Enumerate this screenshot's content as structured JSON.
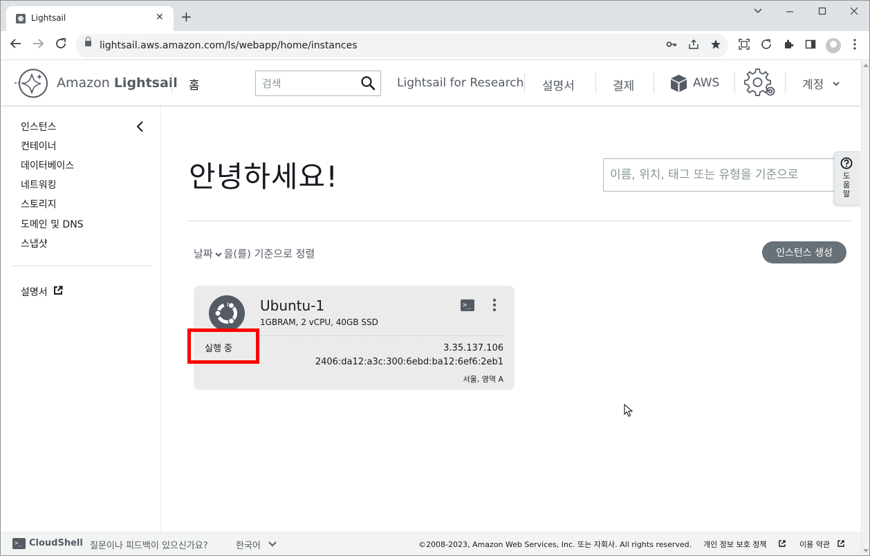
{
  "browser": {
    "tab_title": "Lightsail",
    "tab_close": "✕",
    "new_tab": "+",
    "url": "lightsail.aws.amazon.com/ls/webapp/home/instances"
  },
  "header": {
    "brand_prefix": "Amazon ",
    "brand_bold": "Lightsail",
    "home": "홈",
    "search_placeholder": "검색",
    "research": "Lightsail for Research",
    "docs": "설명서",
    "billing": "결제",
    "aws": "AWS",
    "account": "계정"
  },
  "sidebar": {
    "items": [
      "인스턴스",
      "컨테이너",
      "데이터베이스",
      "네트워킹",
      "스토리지",
      "도메인 및 DNS",
      "스냅샷"
    ],
    "docs": "설명서"
  },
  "main": {
    "greeting": "안녕하세요!",
    "filter_placeholder": "이름, 위치, 태그 또는 유형을 기준으로",
    "sort_field": "날짜",
    "sort_suffix": "을(를) 기준으로 정렬",
    "create_button": "인스턴스 생성",
    "help": "도움말"
  },
  "instance": {
    "name": "Ubuntu-1",
    "spec": "1GBRAM, 2 vCPU, 40GB SSD",
    "status": "실행 중",
    "ipv4": "3.35.137.106",
    "ipv6": "2406:da12:a3c:300:6ebd:ba12:6ef6:2eb1",
    "region": "서울, 영역 A",
    "terminal": ">_"
  },
  "footer": {
    "cloudshell": "CloudShell",
    "feedback": "질문이나 피드백이 있으신가요?",
    "language": "한국어",
    "copyright": "©2008-2023, Amazon Web Services, Inc. 또는 자회사. All rights reserved.",
    "privacy": "개인 정보 보호 정책",
    "terms": "이용 약관"
  },
  "colors": {
    "highlight": "#ff0000",
    "button": "#687078",
    "card": "#ebebeb"
  }
}
